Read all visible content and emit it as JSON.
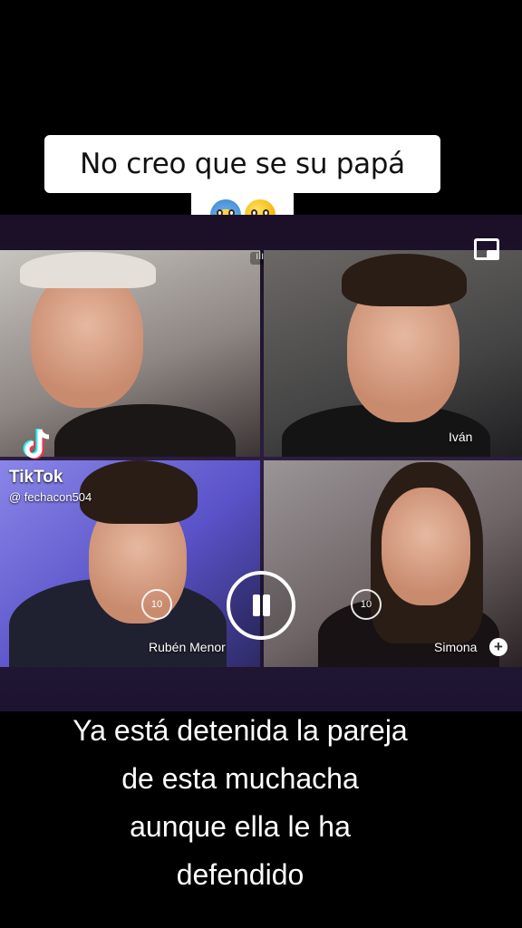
{
  "caption_top": {
    "text": "No creo que se su papá",
    "emojis": [
      "face-screaming-in-fear",
      "flushed-face"
    ]
  },
  "call": {
    "participants": [
      {
        "name": ""
      },
      {
        "name": "Iván"
      },
      {
        "name": "Rubén Menor"
      },
      {
        "name": "Simona"
      }
    ],
    "replay_label": "10"
  },
  "watermark": {
    "brand": "TikTok",
    "handle": "@ fechacon504"
  },
  "caption_bottom": {
    "lines": [
      "Ya está detenida la pareja",
      "de esta muchacha",
      "aunque ella le ha",
      "defendido"
    ]
  },
  "colors": {
    "background": "#000000",
    "caption_bg": "#ffffff",
    "call_band": "#2b1d3f"
  }
}
